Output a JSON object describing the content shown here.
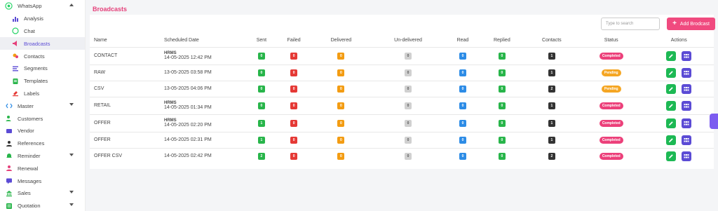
{
  "sidebar": {
    "items": [
      {
        "label": "WhatsApp",
        "icon": "whatsapp-icon",
        "caret": "up"
      },
      {
        "label": "Analysis",
        "icon": "bar-chart-icon",
        "sub": true
      },
      {
        "label": "Chat",
        "icon": "chat-icon",
        "sub": true
      },
      {
        "label": "Broadcasts",
        "icon": "broadcast-icon",
        "sub": true,
        "active": true
      },
      {
        "label": "Contacts",
        "icon": "contacts-icon",
        "sub": true
      },
      {
        "label": "Segments",
        "icon": "segments-icon",
        "sub": true
      },
      {
        "label": "Templates",
        "icon": "template-icon",
        "sub": true
      },
      {
        "label": "Labels",
        "icon": "label-icon",
        "sub": true
      },
      {
        "label": "Master",
        "icon": "code-icon",
        "caret": "down"
      },
      {
        "label": "Customers",
        "icon": "customers-icon"
      },
      {
        "label": "Vendor",
        "icon": "vendor-icon"
      },
      {
        "label": "References",
        "icon": "references-icon"
      },
      {
        "label": "Reminder",
        "icon": "bell-icon",
        "caret": "down"
      },
      {
        "label": "Renewal",
        "icon": "renewal-icon"
      },
      {
        "label": "Messages",
        "icon": "messages-icon"
      },
      {
        "label": "Sales",
        "icon": "sales-icon",
        "caret": "down"
      },
      {
        "label": "Quotation",
        "icon": "quotation-icon",
        "caret": "down"
      }
    ]
  },
  "page": {
    "title": "Broadcasts",
    "search_placeholder": "Type to search",
    "add_label": "Add Brodcast"
  },
  "table": {
    "headers": [
      "Name",
      "Scheduled Date",
      "Sent",
      "Failed",
      "Delivered",
      "Un-delivered",
      "Read",
      "Replied",
      "Contacts",
      "Status",
      "Actions"
    ],
    "rows": [
      {
        "name": "CONTACT",
        "org": "HRMS",
        "date": "14-05-2025 12:42 PM",
        "sent": "0",
        "failed": "0",
        "delivered": "0",
        "undelivered": "0",
        "read": "0",
        "replied": "0",
        "contacts": "1",
        "status": "Completed"
      },
      {
        "name": "RAW",
        "org": "",
        "date": "13-05-2025 03:58 PM",
        "sent": "0",
        "failed": "0",
        "delivered": "0",
        "undelivered": "0",
        "read": "0",
        "replied": "0",
        "contacts": "1",
        "status": "Pending"
      },
      {
        "name": "CSV",
        "org": "",
        "date": "13-05-2025 04:06 PM",
        "sent": "0",
        "failed": "0",
        "delivered": "0",
        "undelivered": "0",
        "read": "0",
        "replied": "0",
        "contacts": "2",
        "status": "Pending"
      },
      {
        "name": "RETAIL",
        "org": "HRMS",
        "date": "14-05-2025 01:34 PM",
        "sent": "0",
        "failed": "0",
        "delivered": "0",
        "undelivered": "0",
        "read": "0",
        "replied": "0",
        "contacts": "1",
        "status": "Completed"
      },
      {
        "name": "OFFER",
        "org": "HRMS",
        "date": "14-05-2025 02:20 PM",
        "sent": "1",
        "failed": "0",
        "delivered": "0",
        "undelivered": "0",
        "read": "0",
        "replied": "0",
        "contacts": "1",
        "status": "Completed"
      },
      {
        "name": "OFFER",
        "org": "",
        "date": "14-05-2025 02:31 PM",
        "sent": "1",
        "failed": "0",
        "delivered": "0",
        "undelivered": "0",
        "read": "0",
        "replied": "0",
        "contacts": "1",
        "status": "Completed"
      },
      {
        "name": "OFFER CSV",
        "org": "",
        "date": "14-05-2025 02:42 PM",
        "sent": "2",
        "failed": "0",
        "delivered": "0",
        "undelivered": "0",
        "read": "0",
        "replied": "0",
        "contacts": "2",
        "status": "Completed"
      }
    ]
  },
  "colors": {
    "accent": "#e5407a",
    "sent": "#28b54a",
    "failed": "#e53935",
    "delivered": "#f39c12",
    "undelivered": "#d0d0d0",
    "read": "#2d8ce6",
    "replied": "#28b54a",
    "contacts": "#333333",
    "completed": "#ec407a",
    "pending": "#f5a623",
    "edit": "#1db954",
    "grid": "#5b4bd5"
  }
}
